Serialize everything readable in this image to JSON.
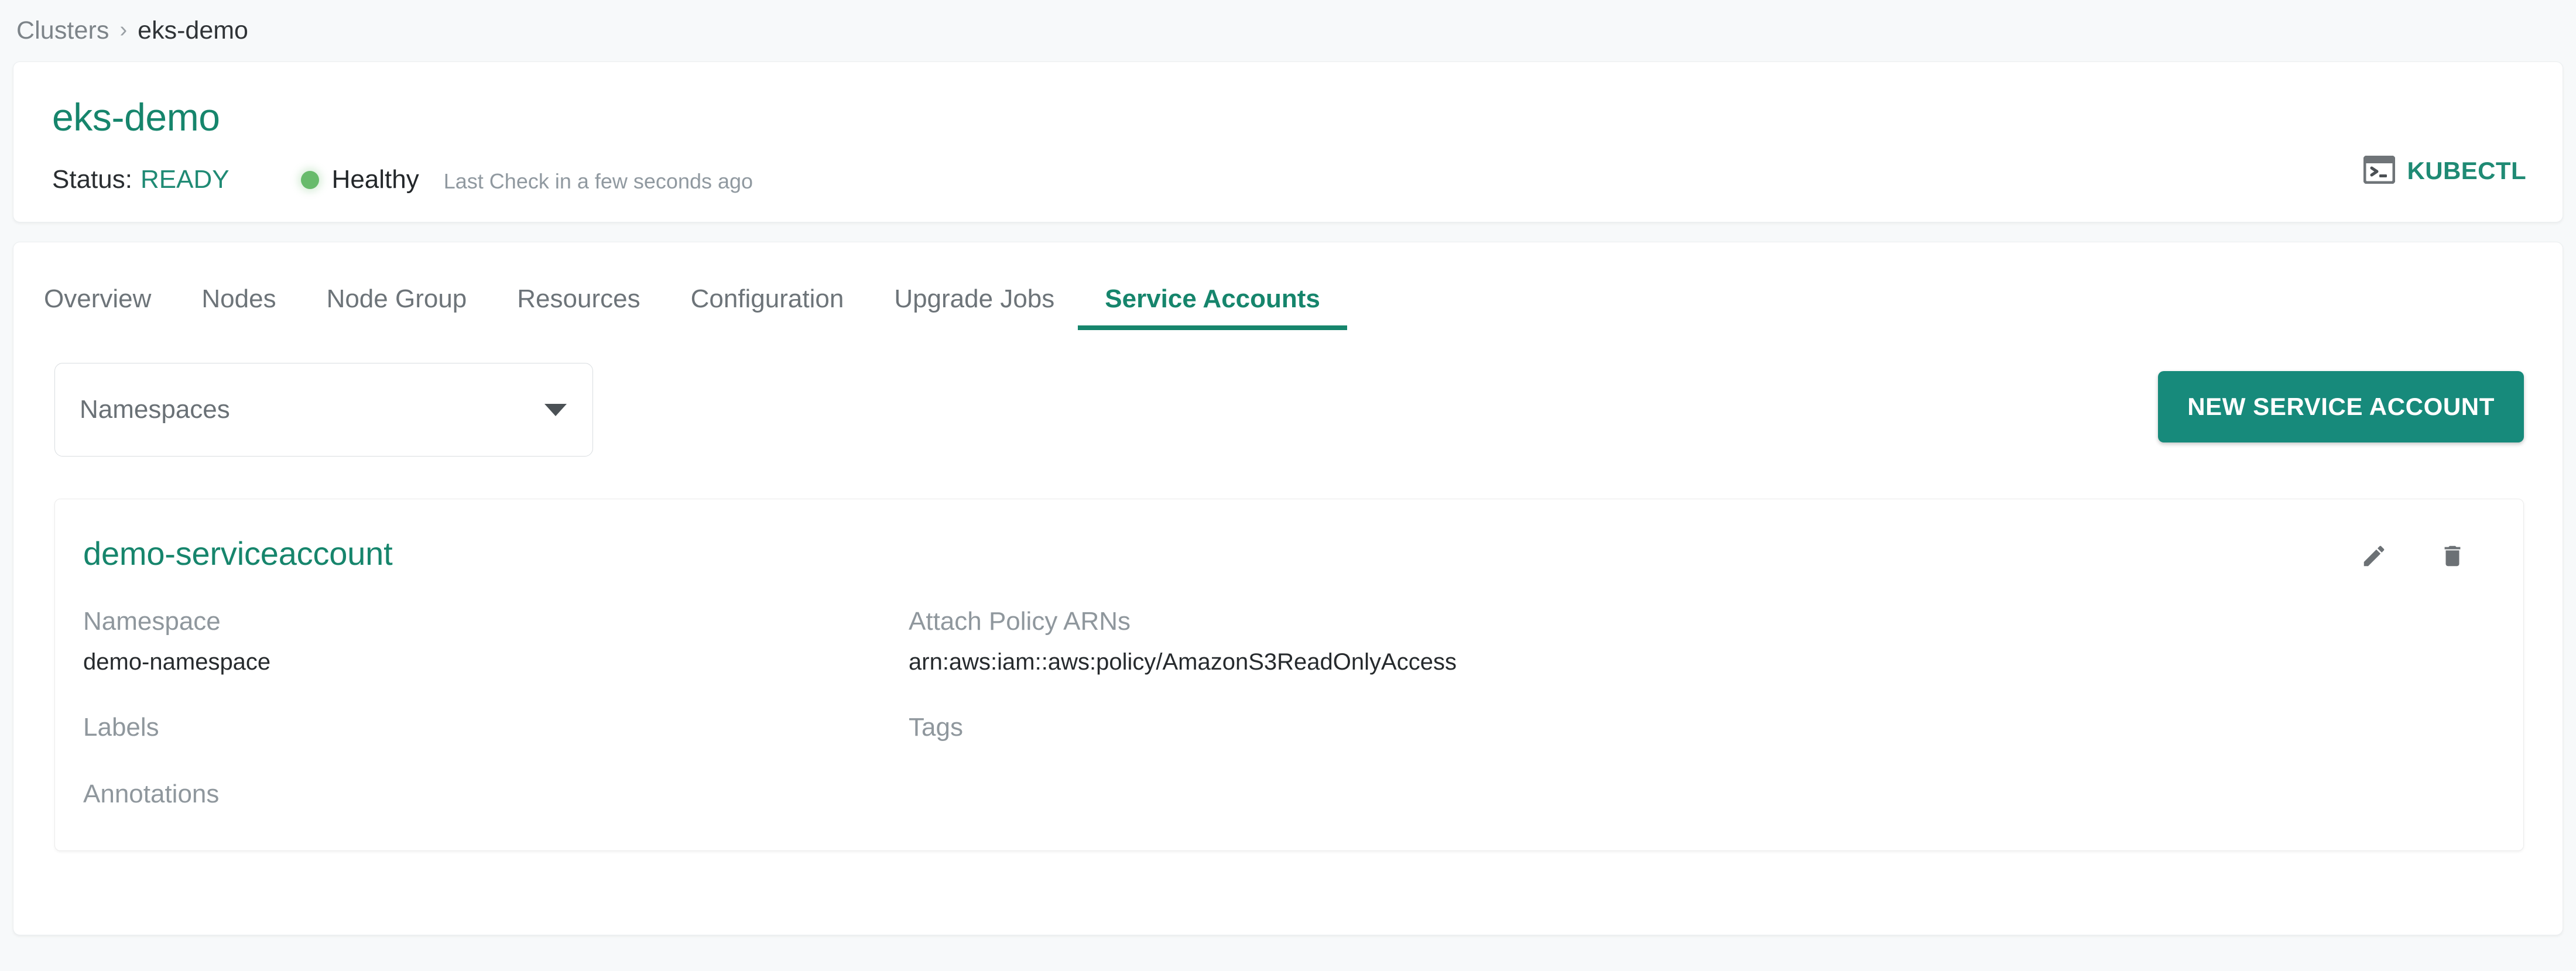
{
  "breadcrumb": {
    "parent": "Clusters",
    "separator": "›",
    "current": "eks-demo"
  },
  "header": {
    "cluster_name": "eks-demo",
    "status_label": "Status:",
    "status_value": "READY",
    "health_text": "Healthy",
    "last_check": "Last Check in a few seconds ago",
    "kubectl_label": "KUBECTL",
    "kubectl_icon": "terminal-icon",
    "health_dot_color": "#68bb6c",
    "accent_color": "#16856c"
  },
  "tabs": [
    {
      "label": "Overview",
      "active": false
    },
    {
      "label": "Nodes",
      "active": false
    },
    {
      "label": "Node Group",
      "active": false
    },
    {
      "label": "Resources",
      "active": false
    },
    {
      "label": "Configuration",
      "active": false
    },
    {
      "label": "Upgrade Jobs",
      "active": false
    },
    {
      "label": "Service Accounts",
      "active": true
    }
  ],
  "controls": {
    "namespace_select_value": "Namespaces",
    "new_service_account_label": "NEW SERVICE ACCOUNT",
    "button_color": "#178a7b"
  },
  "service_account": {
    "name": "demo-serviceaccount",
    "edit_icon": "pencil-icon",
    "delete_icon": "trash-icon",
    "fields": {
      "namespace_label": "Namespace",
      "namespace_value": "demo-namespace",
      "policy_label": "Attach Policy ARNs",
      "policy_value": "arn:aws:iam::aws:policy/AmazonS3ReadOnlyAccess",
      "labels_label": "Labels",
      "labels_value": "",
      "tags_label": "Tags",
      "tags_value": "",
      "annotations_label": "Annotations",
      "annotations_value": ""
    }
  }
}
